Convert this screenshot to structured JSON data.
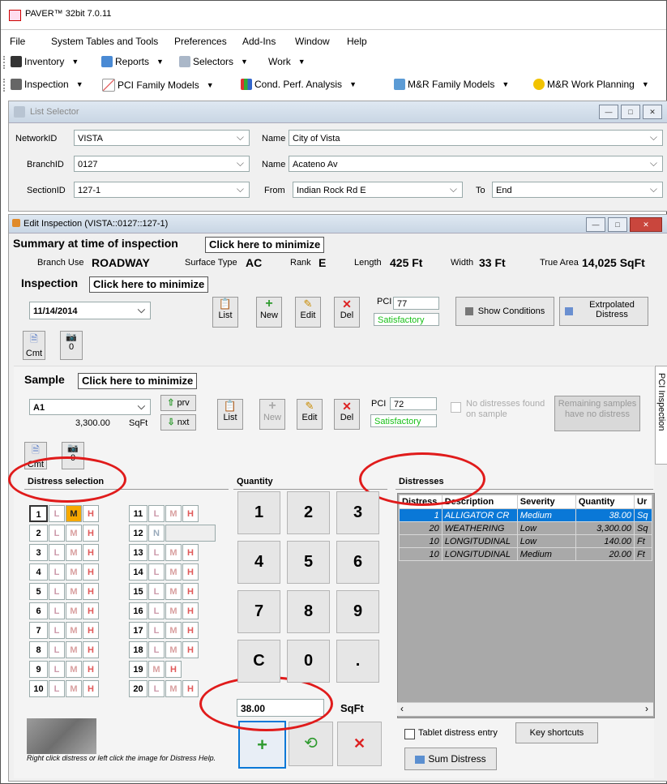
{
  "app": {
    "title": "PAVER™ 32bit 7.0.11"
  },
  "menu": [
    "File",
    "System Tables and Tools",
    "Preferences",
    "Add-Ins",
    "Window",
    "Help"
  ],
  "toolbar1": [
    "Inventory",
    "Reports",
    "Selectors",
    "Work"
  ],
  "toolbar2": [
    "Inspection",
    "PCI Family Models",
    "Cond. Perf. Analysis",
    "M&R Family Models",
    "M&R Work Planning"
  ],
  "list_selector": {
    "title": "List Selector",
    "network_label": "NetworkID",
    "network_value": "VISTA",
    "network_name_label": "Name",
    "network_name": "City of Vista",
    "branch_label": "BranchID",
    "branch_value": "0127",
    "branch_name_label": "Name",
    "branch_name": "Acateno Av",
    "section_label": "SectionID",
    "section_value": "127-1",
    "from_label": "From",
    "from_value": "Indian Rock Rd E",
    "to_label": "To",
    "to_value": "End"
  },
  "edit": {
    "title": "Edit Inspection (VISTA::0127::127-1)",
    "summary_title": "Summary at time of inspection",
    "minimize": "Click here to minimize",
    "branch_use_label": "Branch Use",
    "branch_use": "ROADWAY",
    "surface_label": "Surface Type",
    "surface": "AC",
    "rank_label": "Rank",
    "rank": "E",
    "length_label": "Length",
    "length": "425 Ft",
    "width_label": "Width",
    "width": "33 Ft",
    "area_label": "True Area",
    "area": "14,025 SqFt",
    "inspection_title": "Inspection",
    "inspection_date": "11/14/2014",
    "list": "List",
    "new": "New",
    "edit": "Edit",
    "del": "Del",
    "pci_label": "PCI",
    "pci": "77",
    "pci_rating": "Satisfactory",
    "show_conditions": "Show Conditions",
    "extrapolated": "Extrpolated Distress",
    "cmt": "Cmt",
    "cmt_count": "0",
    "sample_title": "Sample",
    "sample_id": "A1",
    "sample_area": "3,300.00",
    "sample_unit": "SqFt",
    "prv": "prv",
    "nxt": "nxt",
    "sample_pci": "72",
    "sample_rating": "Satisfactory",
    "no_distress": "No distresses found on sample",
    "remaining": "Remaining samples have no distress",
    "sample_cmt_count": "0",
    "side_tab": "PCI Inspection"
  },
  "distress_selection": {
    "title": "Distress selection",
    "rows_left": [
      "1",
      "2",
      "3",
      "4",
      "5",
      "6",
      "7",
      "8",
      "9",
      "10"
    ],
    "rows_right": [
      "11",
      "12",
      "13",
      "14",
      "15",
      "16",
      "17",
      "18",
      "19",
      "20"
    ],
    "sev": [
      "L",
      "M",
      "H"
    ],
    "help": "Right click distress or left click the image for Distress Help."
  },
  "quantity": {
    "title": "Quantity",
    "keys": [
      "1",
      "2",
      "3",
      "4",
      "5",
      "6",
      "7",
      "8",
      "9",
      "C",
      "0",
      "."
    ],
    "value": "38.00",
    "unit": "SqFt"
  },
  "distresses": {
    "title": "Distresses",
    "columns": [
      "Distress",
      "Description",
      "Severity",
      "Quantity",
      "Ur"
    ],
    "rows": [
      {
        "code": "1",
        "desc": "ALLIGATOR CR",
        "sev": "Medium",
        "qty": "38.00",
        "unit": "Sq"
      },
      {
        "code": "20",
        "desc": "WEATHERING",
        "sev": "Low",
        "qty": "3,300.00",
        "unit": "Sq"
      },
      {
        "code": "10",
        "desc": "LONGITUDINAL",
        "sev": "Low",
        "qty": "140.00",
        "unit": "Ft"
      },
      {
        "code": "10",
        "desc": "LONGITUDINAL",
        "sev": "Medium",
        "qty": "20.00",
        "unit": "Ft"
      }
    ],
    "tablet": "Tablet distress entry",
    "key_shortcuts": "Key shortcuts",
    "sum": "Sum Distress"
  },
  "colors": {
    "accent": "#0a78d7",
    "rating": "#18c018",
    "annotation": "#e01b1b",
    "selected_sev": "#f6a800"
  }
}
